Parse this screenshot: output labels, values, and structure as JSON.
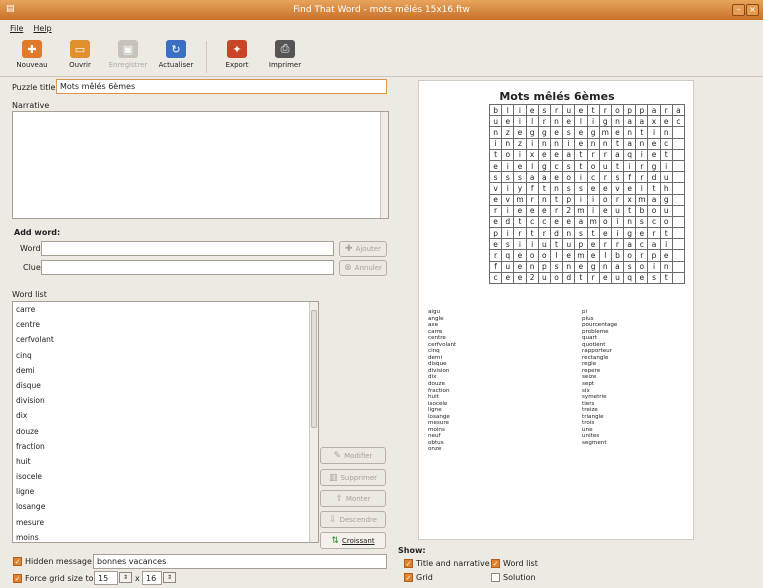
{
  "window": {
    "title": "Find That Word - mots mêlés 15x16.ftw"
  },
  "menu": {
    "file": "File",
    "help": "Help"
  },
  "toolbar": {
    "items": [
      {
        "label": "Nouveau",
        "icon": "new-icon",
        "color": "#e07a2a"
      },
      {
        "label": "Ouvrir",
        "icon": "open-icon",
        "color": "#e0902e"
      },
      {
        "label": "Enregistrer",
        "icon": "save-icon",
        "color": "#c7c2ba"
      },
      {
        "label": "Actualiser",
        "icon": "refresh-icon",
        "color": "#3a6fc2"
      },
      {
        "label": "Export",
        "icon": "export-icon",
        "color": "#cc4428"
      },
      {
        "label": "Imprimer",
        "icon": "print-icon",
        "color": "#555555"
      }
    ]
  },
  "form": {
    "puzzle_title_label": "Puzzle title",
    "puzzle_title": "Mots mêlés 6èmes",
    "narrative_label": "Narrative",
    "narrative": ""
  },
  "add_word": {
    "heading": "Add word:",
    "word_label": "Word",
    "clue_label": "Clue",
    "word_value": "",
    "clue_value": "",
    "add_button": "Ajouter",
    "cancel_button": "Annuler"
  },
  "word_list": {
    "label": "Word list",
    "items": [
      "carre",
      "centre",
      "cerfvolant",
      "cinq",
      "demi",
      "disque",
      "division",
      "dix",
      "douze",
      "fraction",
      "huit",
      "isocele",
      "ligne",
      "losange",
      "mesure",
      "moins",
      "neuf",
      "obtus"
    ]
  },
  "list_buttons": {
    "modify": "Modifier",
    "delete": "Supprimer",
    "up": "Monter",
    "down": "Descendre",
    "ascending": "Croissant"
  },
  "bottom": {
    "hidden_message_label": "Hidden message",
    "hidden_message": "bonnes vacances",
    "force_grid_label": "Force grid size to",
    "grid_w": "15",
    "times": "x",
    "grid_h": "16"
  },
  "show": {
    "label": "Show:",
    "title_narrative": "Title and narrative",
    "word_list": "Word list",
    "grid": "Grid",
    "solution": "Solution",
    "title_narrative_on": true,
    "word_list_on": true,
    "grid_on": true,
    "solution_on": false
  },
  "preview": {
    "title": "Mots mêlés 6èmes",
    "grid": [
      "bliesruetroppara",
      "ueilrnelignaaxec",
      "nzeggesegmentin",
      "inzinnienntanec",
      "toixeeatrraqiet",
      "eielgcstoutirgi",
      "sssaaeoicrsfrdu",
      "viyftnsseeveith",
      "evmrntpiiorxmag",
      "rieeer2mieutbou",
      "edtcceeamoinsco",
      "pirtrdnsteigert",
      "esiiutuperracai",
      "rqeoolemelborpe",
      "fuenpsnegnasoin",
      "cee2uodtreuqest"
    ],
    "words_left": [
      "aigu",
      "angle",
      "axe",
      "carre",
      "centre",
      "cerfvolant",
      "cinq",
      "demi",
      "disque",
      "division",
      "dix",
      "douze",
      "fraction",
      "huit",
      "isocele",
      "ligne",
      "losange",
      "mesure",
      "moins",
      "neuf",
      "obtus",
      "onze"
    ],
    "words_right": [
      "pi",
      "plus",
      "pourcentage",
      "probleme",
      "quart",
      "quotient",
      "rapporteur",
      "rectangle",
      "regle",
      "repere",
      "seize",
      "sept",
      "six",
      "symetrie",
      "tiers",
      "treize",
      "triangle",
      "trois",
      "une",
      "unites",
      "segment"
    ]
  }
}
